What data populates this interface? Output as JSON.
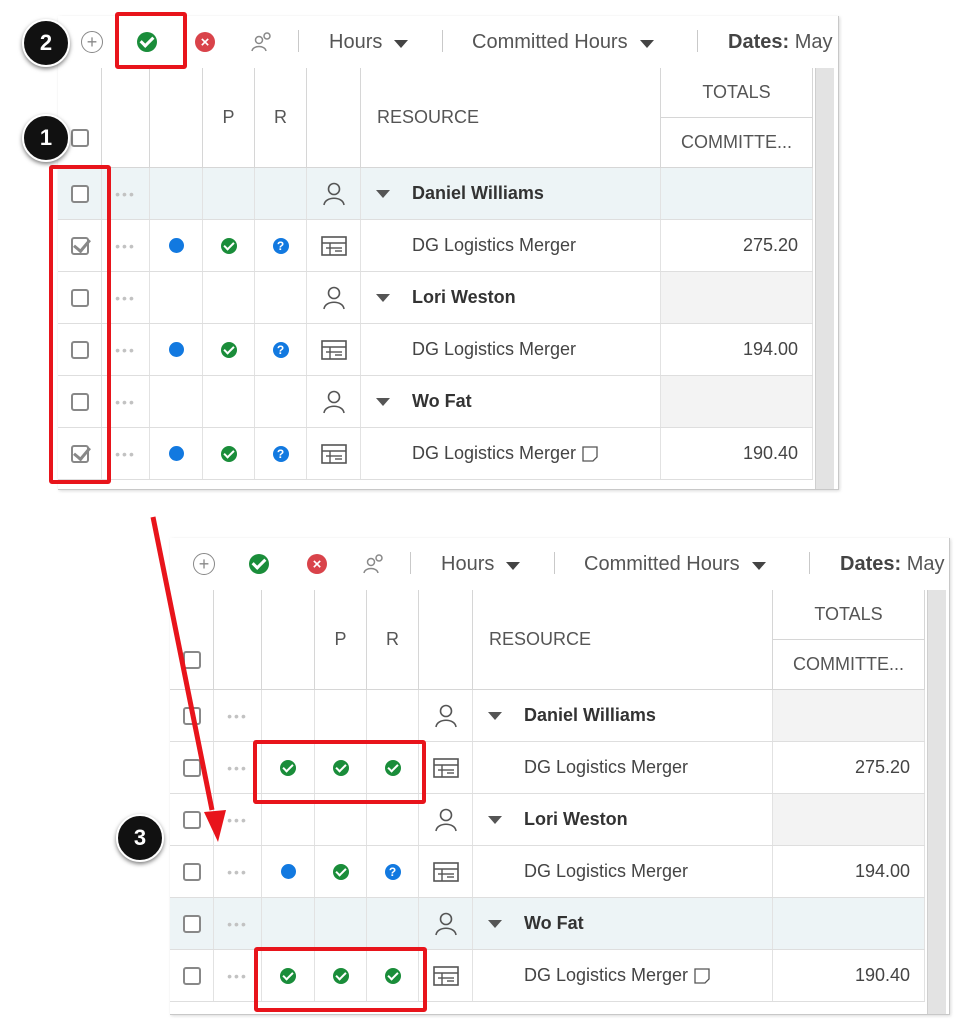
{
  "toolbar": {
    "hours_label": "Hours",
    "committed_label": "Committed Hours",
    "dates_label": "Dates:",
    "dates_value": "May"
  },
  "columns": {
    "p": "P",
    "r": "R",
    "resource": "RESOURCE",
    "totals": "TOTALS",
    "committed": "COMMITTE..."
  },
  "before": {
    "rows": [
      {
        "type": "resource",
        "name": "Daniel Williams",
        "checked": false
      },
      {
        "type": "project",
        "name": "DG Logistics Merger",
        "p": "approved",
        "r": "question",
        "status": "blue",
        "checked": true,
        "total": "275.20",
        "note": false
      },
      {
        "type": "resource",
        "name": "Lori Weston",
        "checked": false
      },
      {
        "type": "project",
        "name": "DG Logistics Merger",
        "p": "approved",
        "r": "question",
        "status": "blue",
        "checked": false,
        "total": "194.00",
        "note": false
      },
      {
        "type": "resource",
        "name": "Wo Fat",
        "checked": false
      },
      {
        "type": "project",
        "name": "DG Logistics Merger",
        "p": "approved",
        "r": "question",
        "status": "blue",
        "checked": true,
        "total": "190.40",
        "note": true
      }
    ]
  },
  "after": {
    "rows": [
      {
        "type": "resource",
        "name": "Daniel Williams",
        "checked": false
      },
      {
        "type": "project",
        "name": "DG Logistics Merger",
        "p": "approved",
        "r": "approved",
        "status": "approved",
        "checked": false,
        "total": "275.20",
        "note": false
      },
      {
        "type": "resource",
        "name": "Lori Weston",
        "checked": false
      },
      {
        "type": "project",
        "name": "DG Logistics Merger",
        "p": "approved",
        "r": "question",
        "status": "blue",
        "checked": false,
        "total": "194.00",
        "note": false
      },
      {
        "type": "resource",
        "name": "Wo Fat",
        "checked": false
      },
      {
        "type": "project",
        "name": "DG Logistics Merger",
        "p": "approved",
        "r": "approved",
        "status": "approved",
        "checked": false,
        "total": "190.40",
        "note": true
      }
    ]
  },
  "badges": [
    "1",
    "2",
    "3"
  ],
  "colors": {
    "accent_red": "#e8141b",
    "approved_green": "#1a8d3a",
    "status_blue": "#1279e0",
    "reject_red": "#d9434a"
  }
}
